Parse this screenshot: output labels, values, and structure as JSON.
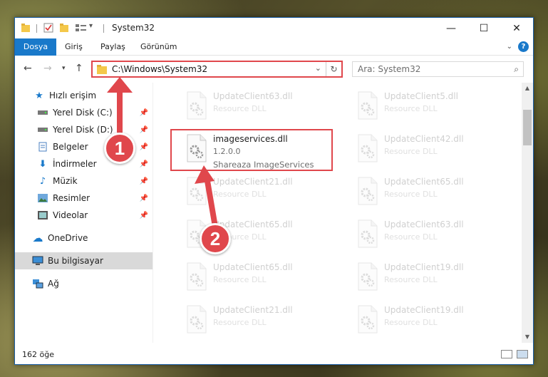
{
  "window": {
    "title": "System32",
    "minimize": "—",
    "maximize": "☐",
    "close": "✕"
  },
  "ribbon": {
    "tabs": [
      "Dosya",
      "Giriş",
      "Paylaş",
      "Görünüm"
    ]
  },
  "address": {
    "path": "C:\\Windows\\System32",
    "dropdown": "⌄",
    "refresh": "↻"
  },
  "search": {
    "placeholder": "Ara: System32"
  },
  "nav": {
    "quick_access": "Hızlı erişim",
    "items": [
      {
        "label": "Yerel Disk (C:)",
        "icon": "drive-icon"
      },
      {
        "label": "Yerel Disk (D:)",
        "icon": "drive-icon"
      },
      {
        "label": "Belgeler",
        "icon": "documents-icon"
      },
      {
        "label": "İndirmeler",
        "icon": "downloads-icon"
      },
      {
        "label": "Müzik",
        "icon": "music-icon"
      },
      {
        "label": "Resimler",
        "icon": "pictures-icon"
      },
      {
        "label": "Videolar",
        "icon": "videos-icon"
      }
    ],
    "onedrive": "OneDrive",
    "this_pc": "Bu bilgisayar",
    "network": "Ağ"
  },
  "files": {
    "left": [
      {
        "name": "UpdateClient63.dll",
        "desc": "Resource DLL"
      },
      {
        "name": "imageservices.dll",
        "desc": "1.2.0.0",
        "sub": "Shareaza ImageServices"
      },
      {
        "name": "UpdateClient21.dll",
        "desc": "Resource DLL"
      },
      {
        "name": "UpdateClient65.dll",
        "desc": "Resource DLL"
      },
      {
        "name": "UpdateClient65.dll",
        "desc": "Resource DLL"
      },
      {
        "name": "UpdateClient21.dll",
        "desc": "Resource DLL"
      }
    ],
    "right": [
      {
        "name": "UpdateClient5.dll",
        "desc": "Resource DLL"
      },
      {
        "name": "UpdateClient42.dll",
        "desc": "Resource DLL"
      },
      {
        "name": "UpdateClient65.dll",
        "desc": "Resource DLL"
      },
      {
        "name": "UpdateClient63.dll",
        "desc": "Resource DLL"
      },
      {
        "name": "UpdateClient19.dll",
        "desc": "Resource DLL"
      },
      {
        "name": "UpdateClient19.dll",
        "desc": "Resource DLL"
      }
    ]
  },
  "status": {
    "count": "162 öğe"
  },
  "annotations": {
    "step1": "1",
    "step2": "2"
  },
  "colors": {
    "accent": "#1979ca",
    "highlight": "#e0474c"
  }
}
